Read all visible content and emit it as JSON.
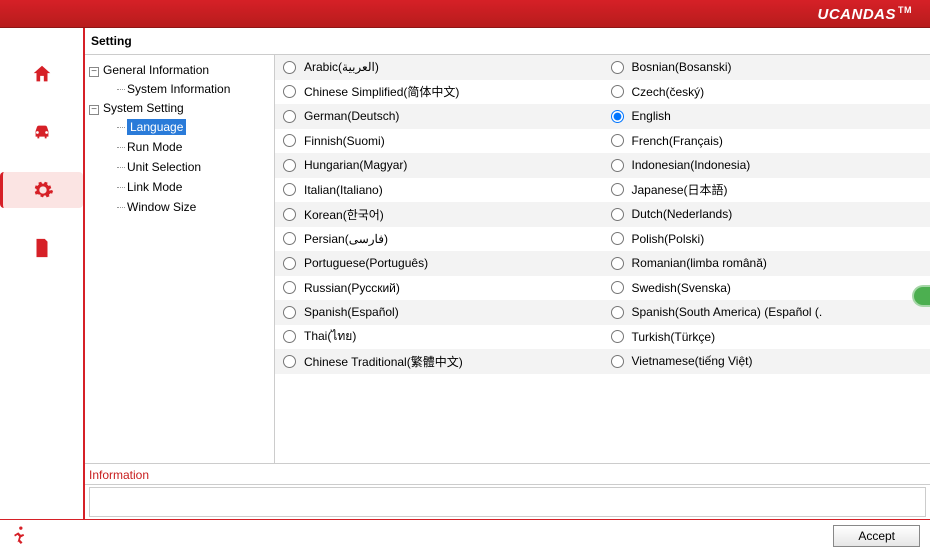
{
  "brand": "UCANDAS",
  "brand_tm": "TM",
  "page_title": "Setting",
  "tree": {
    "group1": {
      "label": "General Information",
      "children": [
        "System Information"
      ]
    },
    "group2": {
      "label": "System Setting",
      "children": [
        "Language",
        "Run Mode",
        "Unit Selection",
        "Link Mode",
        "Window Size"
      ],
      "selected": 0
    }
  },
  "languages_col1": [
    "Arabic(العربية)",
    "Chinese Simplified(简体中文)",
    "German(Deutsch)",
    "Finnish(Suomi)",
    "Hungarian(Magyar)",
    "Italian(Italiano)",
    "Korean(한국어)",
    "Persian(فارسی)",
    "Portuguese(Português)",
    "Russian(Русский)",
    "Spanish(Español)",
    "Thai(ไทย)",
    "Chinese Traditional(繁體中文)"
  ],
  "languages_col2": [
    "Bosnian(Bosanski)",
    "Czech(český)",
    "English",
    "French(Français)",
    "Indonesian(Indonesia)",
    "Japanese(日本語)",
    "Dutch(Nederlands)",
    "Polish(Polski)",
    "Romanian(limba română)",
    "Swedish(Svenska)",
    "Spanish(South America) (Español (.",
    "Turkish(Türkçe)",
    "Vietnamese(tiếng Việt)"
  ],
  "selected_language": "English",
  "info_label": "Information",
  "accept_label": "Accept"
}
